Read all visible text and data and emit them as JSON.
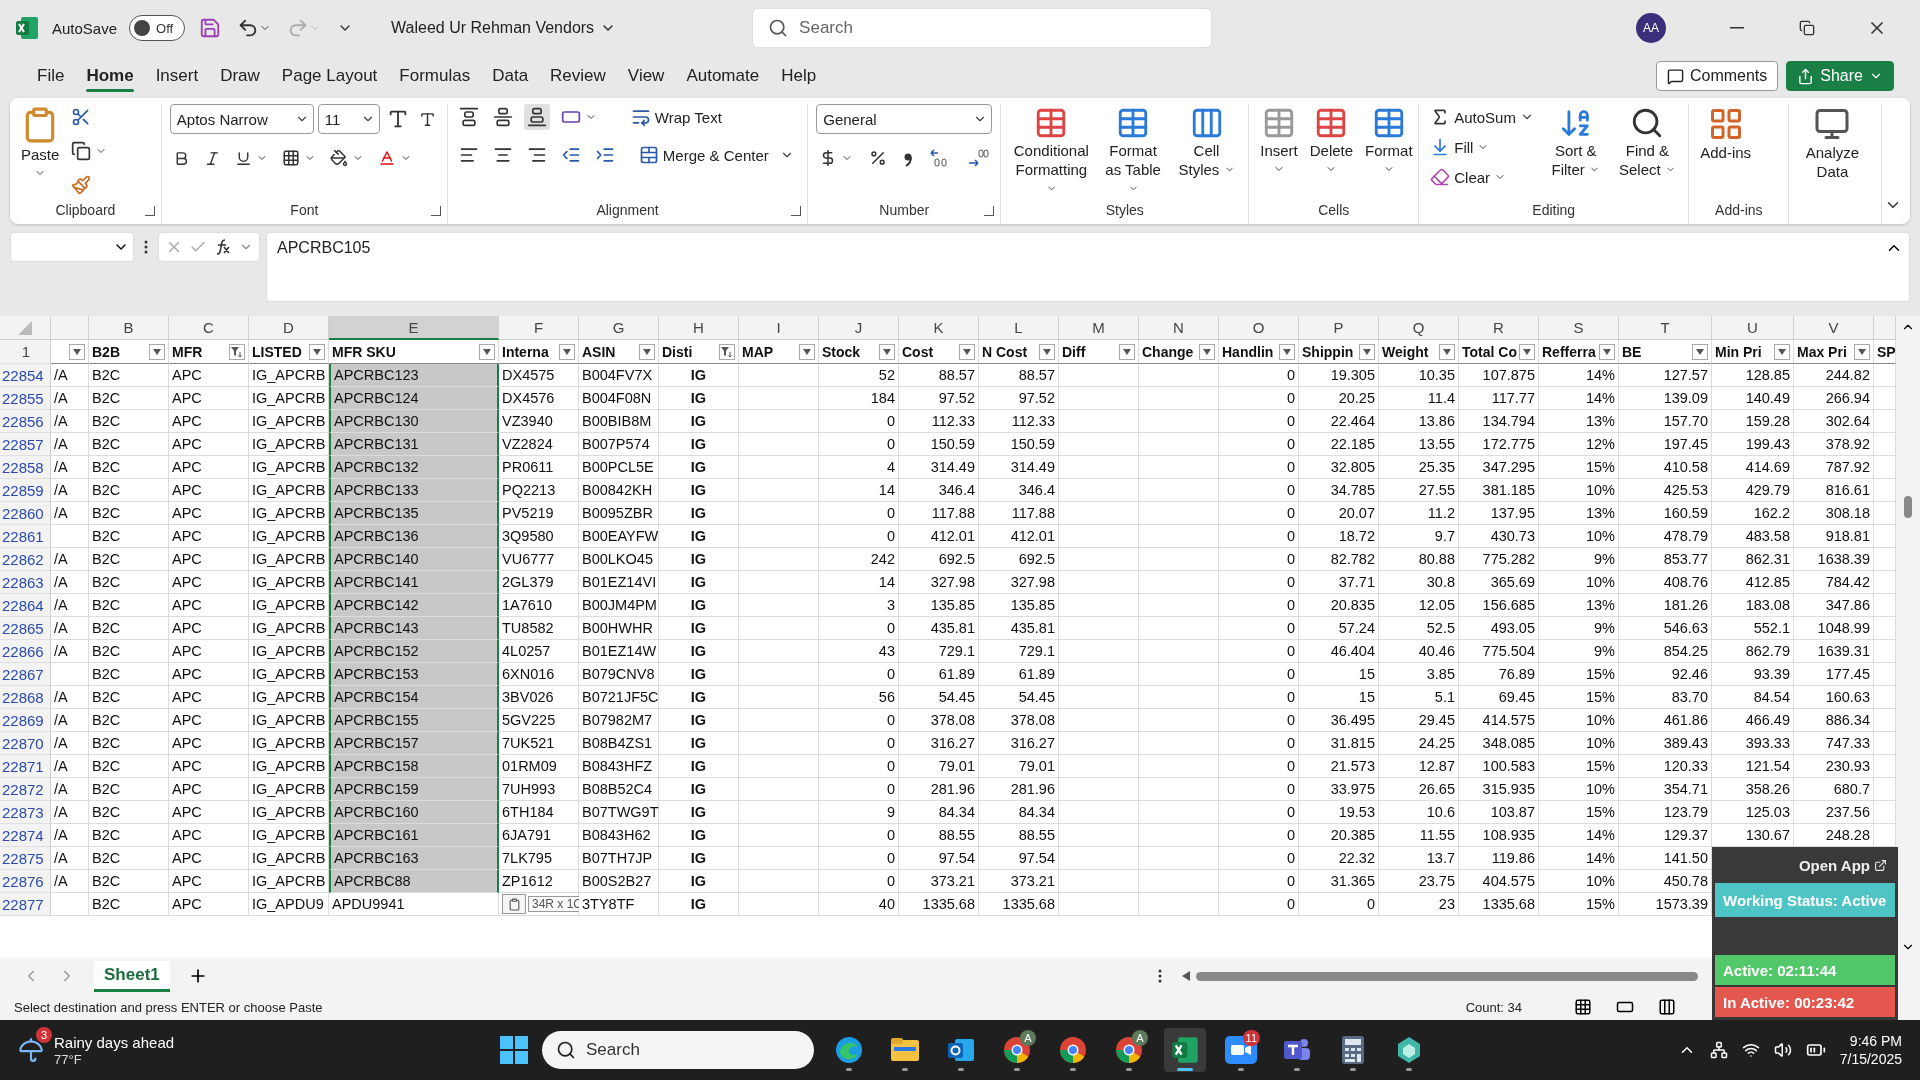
{
  "title_bar": {
    "autosave_label": "AutoSave",
    "autosave": {
      "on": false,
      "label": "Off"
    },
    "document": "Waleed Ur Rehman Vendors",
    "search": {
      "placeholder": "Search"
    },
    "avatar": "AA"
  },
  "menu": {
    "tabs": [
      {
        "label": "File",
        "selected": false
      },
      {
        "label": "Home",
        "selected": true
      },
      {
        "label": "Insert",
        "selected": false
      },
      {
        "label": "Draw",
        "selected": false
      },
      {
        "label": "Page Layout",
        "selected": false
      },
      {
        "label": "Formulas",
        "selected": false
      },
      {
        "label": "Data",
        "selected": false
      },
      {
        "label": "Review",
        "selected": false
      },
      {
        "label": "View",
        "selected": false
      },
      {
        "label": "Automate",
        "selected": false
      },
      {
        "label": "Help",
        "selected": false
      }
    ],
    "comments": "Comments",
    "share": "Share"
  },
  "ribbon": {
    "clipboard": {
      "label": "Clipboard",
      "paste": "Paste"
    },
    "font": {
      "label": "Font",
      "name": "Aptos Narrow",
      "size": "11"
    },
    "alignment": {
      "label": "Alignment",
      "wrap": "Wrap Text",
      "merge": "Merge & Center"
    },
    "number": {
      "label": "Number",
      "format": "General"
    },
    "styles": {
      "label": "Styles",
      "items": [
        "Conditional Formatting",
        "Format as Table",
        "Cell Styles"
      ]
    },
    "cells": {
      "label": "Cells",
      "items": [
        "Insert",
        "Delete",
        "Format"
      ]
    },
    "editing": {
      "label": "Editing",
      "autosum": "AutoSum",
      "fill": "Fill",
      "clear": "Clear",
      "items": [
        "Sort & Filter",
        "Find & Select"
      ]
    },
    "addins": {
      "label": "Add-ins",
      "items": [
        "Add-ins"
      ]
    },
    "analyze": {
      "items": [
        "Analyze Data"
      ]
    }
  },
  "formula_bar": {
    "value": "APCRBC105"
  },
  "columns": [
    {
      "kind": "text",
      "filtered": false
    },
    {
      "letter": "B",
      "header": "B2B",
      "kind": "text",
      "filtered": false
    },
    {
      "letter": "C",
      "header": "MFR",
      "kind": "text",
      "filtered": true
    },
    {
      "letter": "D",
      "header": "LISTED",
      "kind": "text",
      "filtered": false
    },
    {
      "letter": "E",
      "header": "MFR SKU",
      "kind": "text",
      "filtered": false
    },
    {
      "letter": "F",
      "header": "Interna",
      "kind": "text",
      "filtered": false
    },
    {
      "letter": "G",
      "header": "ASIN",
      "kind": "text",
      "filtered": false
    },
    {
      "letter": "H",
      "header": "Disti",
      "kind": "code",
      "filtered": true
    },
    {
      "letter": "I",
      "header": "MAP",
      "kind": "text",
      "filtered": false
    },
    {
      "letter": "J",
      "header": "Stock",
      "kind": "number",
      "filtered": false
    },
    {
      "letter": "K",
      "header": "Cost",
      "kind": "number",
      "filtered": false
    },
    {
      "letter": "L",
      "header": "N Cost",
      "kind": "number",
      "filtered": false
    },
    {
      "letter": "M",
      "header": "Diff",
      "kind": "number",
      "filtered": false
    },
    {
      "letter": "N",
      "header": "Change",
      "kind": "number",
      "filtered": false
    },
    {
      "letter": "O",
      "header": "Handlin",
      "kind": "number",
      "filtered": false
    },
    {
      "letter": "P",
      "header": "Shippin",
      "kind": "number",
      "filtered": false
    },
    {
      "letter": "Q",
      "header": "Weight",
      "kind": "number",
      "filtered": false
    },
    {
      "letter": "R",
      "header": "Total Co",
      "kind": "number",
      "filtered": false
    },
    {
      "letter": "S",
      "header": "Refferra",
      "kind": "number",
      "filtered": false
    },
    {
      "letter": "T",
      "header": "BE",
      "kind": "number",
      "filtered": false
    },
    {
      "letter": "U",
      "header": "Min Pri",
      "kind": "number",
      "filtered": false
    },
    {
      "letter": "V",
      "header": "Max Pri",
      "kind": "number",
      "filtered": false
    },
    {
      "header": "SP",
      "kind": "text"
    }
  ],
  "header_row": "1",
  "rows": [
    {
      "num": "22854",
      "selected": true,
      "cells": [
        "/A",
        "B2C",
        "APC",
        "IG_APCRB",
        "APCRBC123",
        "DX4575",
        "B004FV7X",
        "IG",
        null,
        "52",
        "88.57",
        "88.57",
        null,
        null,
        "0",
        "19.305",
        "10.35",
        "107.875",
        "14%",
        "127.57",
        "128.85",
        "244.82"
      ]
    },
    {
      "num": "22855",
      "selected": true,
      "cells": [
        "/A",
        "B2C",
        "APC",
        "IG_APCRB",
        "APCRBC124",
        "DX4576",
        "B004F08N",
        "IG",
        null,
        "184",
        "97.52",
        "97.52",
        null,
        null,
        "0",
        "20.25",
        "11.4",
        "117.77",
        "14%",
        "139.09",
        "140.49",
        "266.94"
      ]
    },
    {
      "num": "22856",
      "selected": true,
      "cells": [
        "/A",
        "B2C",
        "APC",
        "IG_APCRB",
        "APCRBC130",
        "VZ3940",
        "B00BIB8M",
        "IG",
        null,
        "0",
        "112.33",
        "112.33",
        null,
        null,
        "0",
        "22.464",
        "13.86",
        "134.794",
        "13%",
        "157.70",
        "159.28",
        "302.64"
      ]
    },
    {
      "num": "22857",
      "selected": true,
      "cells": [
        "/A",
        "B2C",
        "APC",
        "IG_APCRB",
        "APCRBC131",
        "VZ2824",
        "B007P574",
        "IG",
        null,
        "0",
        "150.59",
        "150.59",
        null,
        null,
        "0",
        "22.185",
        "13.55",
        "172.775",
        "12%",
        "197.45",
        "199.43",
        "378.92"
      ]
    },
    {
      "num": "22858",
      "selected": true,
      "cells": [
        "/A",
        "B2C",
        "APC",
        "IG_APCRB",
        "APCRBC132",
        "PR0611",
        "B00PCL5E",
        "IG",
        null,
        "4",
        "314.49",
        "314.49",
        null,
        null,
        "0",
        "32.805",
        "25.35",
        "347.295",
        "15%",
        "410.58",
        "414.69",
        "787.92"
      ]
    },
    {
      "num": "22859",
      "selected": true,
      "cells": [
        "/A",
        "B2C",
        "APC",
        "IG_APCRB",
        "APCRBC133",
        "PQ2213",
        "B00842KH",
        "IG",
        null,
        "14",
        "346.4",
        "346.4",
        null,
        null,
        "0",
        "34.785",
        "27.55",
        "381.185",
        "10%",
        "425.53",
        "429.79",
        "816.61"
      ]
    },
    {
      "num": "22860",
      "selected": true,
      "cells": [
        "/A",
        "B2C",
        "APC",
        "IG_APCRB",
        "APCRBC135",
        "PV5219",
        "B0095ZBR",
        "IG",
        null,
        "0",
        "117.88",
        "117.88",
        null,
        null,
        "0",
        "20.07",
        "11.2",
        "137.95",
        "13%",
        "160.59",
        "162.2",
        "308.18"
      ]
    },
    {
      "num": "22861",
      "selected": true,
      "cells": [
        null,
        "B2C",
        "APC",
        "IG_APCRB",
        "APCRBC136",
        "3Q9580",
        "B00EAYFW",
        "IG",
        null,
        "0",
        "412.01",
        "412.01",
        null,
        null,
        "0",
        "18.72",
        "9.7",
        "430.73",
        "10%",
        "478.79",
        "483.58",
        "918.81"
      ]
    },
    {
      "num": "22862",
      "selected": true,
      "cells": [
        "/A",
        "B2C",
        "APC",
        "IG_APCRB",
        "APCRBC140",
        "VU6777",
        "B00LKO45",
        "IG",
        null,
        "242",
        "692.5",
        "692.5",
        null,
        null,
        "0",
        "82.782",
        "80.88",
        "775.282",
        "9%",
        "853.77",
        "862.31",
        "1638.39"
      ]
    },
    {
      "num": "22863",
      "selected": true,
      "cells": [
        "/A",
        "B2C",
        "APC",
        "IG_APCRB",
        "APCRBC141",
        "2GL379",
        "B01EZ14VI",
        "IG",
        null,
        "14",
        "327.98",
        "327.98",
        null,
        null,
        "0",
        "37.71",
        "30.8",
        "365.69",
        "10%",
        "408.76",
        "412.85",
        "784.42"
      ]
    },
    {
      "num": "22864",
      "selected": true,
      "cells": [
        "/A",
        "B2C",
        "APC",
        "IG_APCRB",
        "APCRBC142",
        "1A7610",
        "B00JM4PM",
        "IG",
        null,
        "3",
        "135.85",
        "135.85",
        null,
        null,
        "0",
        "20.835",
        "12.05",
        "156.685",
        "13%",
        "181.26",
        "183.08",
        "347.86"
      ]
    },
    {
      "num": "22865",
      "selected": true,
      "cells": [
        "/A",
        "B2C",
        "APC",
        "IG_APCRB",
        "APCRBC143",
        "TU8582",
        "B00HWHR",
        "IG",
        null,
        "0",
        "435.81",
        "435.81",
        null,
        null,
        "0",
        "57.24",
        "52.5",
        "493.05",
        "9%",
        "546.63",
        "552.1",
        "1048.99"
      ]
    },
    {
      "num": "22866",
      "selected": true,
      "cells": [
        "/A",
        "B2C",
        "APC",
        "IG_APCRB",
        "APCRBC152",
        "4L0257",
        "B01EZ14W",
        "IG",
        null,
        "43",
        "729.1",
        "729.1",
        null,
        null,
        "0",
        "46.404",
        "40.46",
        "775.504",
        "9%",
        "854.25",
        "862.79",
        "1639.31"
      ]
    },
    {
      "num": "22867",
      "selected": true,
      "cells": [
        null,
        "B2C",
        "APC",
        "IG_APCRB",
        "APCRBC153",
        "6XN016",
        "B079CNV8",
        "IG",
        null,
        "0",
        "61.89",
        "61.89",
        null,
        null,
        "0",
        "15",
        "3.85",
        "76.89",
        "15%",
        "92.46",
        "93.39",
        "177.45"
      ]
    },
    {
      "num": "22868",
      "selected": true,
      "cells": [
        "/A",
        "B2C",
        "APC",
        "IG_APCRB",
        "APCRBC154",
        "3BV026",
        "B0721JF5C",
        "IG",
        null,
        "56",
        "54.45",
        "54.45",
        null,
        null,
        "0",
        "15",
        "5.1",
        "69.45",
        "15%",
        "83.70",
        "84.54",
        "160.63"
      ]
    },
    {
      "num": "22869",
      "selected": true,
      "cells": [
        "/A",
        "B2C",
        "APC",
        "IG_APCRB",
        "APCRBC155",
        "5GV225",
        "B07982M7",
        "IG",
        null,
        "0",
        "378.08",
        "378.08",
        null,
        null,
        "0",
        "36.495",
        "29.45",
        "414.575",
        "10%",
        "461.86",
        "466.49",
        "886.34"
      ]
    },
    {
      "num": "22870",
      "selected": true,
      "cells": [
        "/A",
        "B2C",
        "APC",
        "IG_APCRB",
        "APCRBC157",
        "7UK521",
        "B08B4ZS1",
        "IG",
        null,
        "0",
        "316.27",
        "316.27",
        null,
        null,
        "0",
        "31.815",
        "24.25",
        "348.085",
        "10%",
        "389.43",
        "393.33",
        "747.33"
      ]
    },
    {
      "num": "22871",
      "selected": true,
      "cells": [
        "/A",
        "B2C",
        "APC",
        "IG_APCRB",
        "APCRBC158",
        "01RM09",
        "B0843HFZ",
        "IG",
        null,
        "0",
        "79.01",
        "79.01",
        null,
        null,
        "0",
        "21.573",
        "12.87",
        "100.583",
        "15%",
        "120.33",
        "121.54",
        "230.93"
      ]
    },
    {
      "num": "22872",
      "selected": true,
      "cells": [
        "/A",
        "B2C",
        "APC",
        "IG_APCRB",
        "APCRBC159",
        "7UH993",
        "B08B52C4",
        "IG",
        null,
        "0",
        "281.96",
        "281.96",
        null,
        null,
        "0",
        "33.975",
        "26.65",
        "315.935",
        "10%",
        "354.71",
        "358.26",
        "680.7"
      ]
    },
    {
      "num": "22873",
      "selected": true,
      "cells": [
        "/A",
        "B2C",
        "APC",
        "IG_APCRB",
        "APCRBC160",
        "6TH184",
        "B07TWG9T",
        "IG",
        null,
        "9",
        "84.34",
        "84.34",
        null,
        null,
        "0",
        "19.53",
        "10.6",
        "103.87",
        "15%",
        "123.79",
        "125.03",
        "237.56"
      ]
    },
    {
      "num": "22874",
      "selected": true,
      "cells": [
        "/A",
        "B2C",
        "APC",
        "IG_APCRB",
        "APCRBC161",
        "6JA791",
        "B0843H62",
        "IG",
        null,
        "0",
        "88.55",
        "88.55",
        null,
        null,
        "0",
        "20.385",
        "11.55",
        "108.935",
        "14%",
        "129.37",
        "130.67",
        "248.28"
      ]
    },
    {
      "num": "22875",
      "selected": true,
      "cells": [
        "/A",
        "B2C",
        "APC",
        "IG_APCRB",
        "APCRBC163",
        "7LK795",
        "B07TH7JP",
        "IG",
        null,
        "0",
        "97.54",
        "97.54",
        null,
        null,
        "0",
        "22.32",
        "13.7",
        "119.86",
        "14%",
        "141.50",
        null,
        null
      ]
    },
    {
      "num": "22876",
      "selected": true,
      "cells": [
        "/A",
        "B2C",
        "APC",
        "IG_APCRB",
        "APCRBC88",
        "ZP1612",
        "B00S2B27",
        "IG",
        null,
        "0",
        "373.21",
        "373.21",
        null,
        null,
        "0",
        "31.365",
        "23.75",
        "404.575",
        "10%",
        "450.78",
        null,
        null
      ]
    },
    {
      "num": "22877",
      "selected": false,
      "paste_hint": "34R x 1C",
      "cells": [
        null,
        "B2C",
        "APC",
        "IG_APDU9",
        "APDU9941",
        null,
        "3TY8TF",
        "IG",
        null,
        "40",
        "1335.68",
        "1335.68",
        null,
        null,
        "0",
        "0",
        "23",
        "1335.68",
        "15%",
        "1573.39",
        null,
        null
      ]
    }
  ],
  "sheets": [
    {
      "label": "Sheet1",
      "selected": true
    }
  ],
  "status_bar": {
    "message": "Select destination and press ENTER or choose Paste",
    "count": "Count: 34"
  },
  "tracker": {
    "open_app": "Open App",
    "working": "Working Status: Active",
    "active": "Active: 02:11:44",
    "inactive": "In Active: 00:23:42"
  },
  "taskbar": {
    "weather_badge": "3",
    "weather_title": "Rainy days ahead",
    "weather_temp": "77°F",
    "search": {
      "placeholder": "Search"
    },
    "apps": [
      {
        "kind": "edge",
        "active": false
      },
      {
        "kind": "explorer",
        "active": false
      },
      {
        "kind": "outlook",
        "active": false
      },
      {
        "kind": "chrome",
        "badge": "A",
        "active": false
      },
      {
        "kind": "chrome",
        "active": false
      },
      {
        "kind": "chrome",
        "badge": "A",
        "active": false
      },
      {
        "kind": "excel",
        "active": true
      },
      {
        "kind": "zoom",
        "badge": "11",
        "active": false
      },
      {
        "kind": "teams",
        "active": false
      },
      {
        "kind": "calculator",
        "active": false
      },
      {
        "kind": "app",
        "active": false
      }
    ],
    "time": "9:46 PM",
    "date": "7/15/2025"
  }
}
